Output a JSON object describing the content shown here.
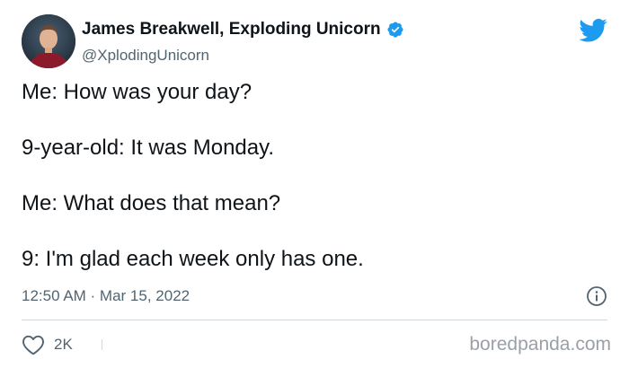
{
  "author": {
    "name": "James Breakwell, Exploding Unicorn",
    "handle": "@XplodingUnicorn",
    "verified_icon": "verified-badge-icon",
    "avatar_icon": "avatar-photo"
  },
  "brand": {
    "icon": "twitter-bird-icon",
    "color": "#1d9bf0"
  },
  "tweet": {
    "lines": [
      "Me: How was your day?",
      "9-year-old: It was Monday.",
      "Me: What does that mean?",
      "9: I'm glad each week only has one."
    ],
    "timestamp": "12:50 AM · Mar 15, 2022"
  },
  "actions": {
    "like_icon": "heart-icon",
    "like_count": "2K",
    "info_icon": "info-icon"
  },
  "watermark": "boredpanda.com",
  "colors": {
    "text_primary": "#0f1419",
    "text_secondary": "#536471",
    "divider": "#cfd9de",
    "verified": "#1d9bf0",
    "watermark": "#9aa0a6"
  }
}
